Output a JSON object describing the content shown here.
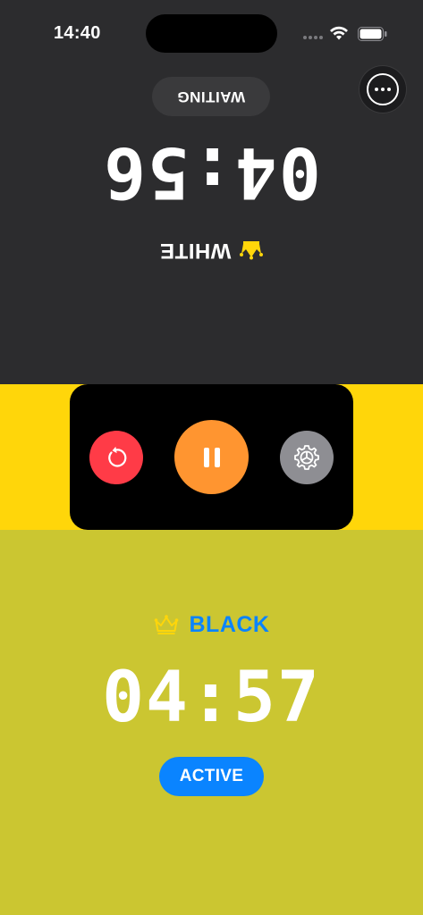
{
  "status_bar": {
    "time": "14:40",
    "icons": [
      "cellular-signal-icon",
      "wifi-icon",
      "battery-icon"
    ]
  },
  "top_player": {
    "name": "WHITE",
    "time": "04:56",
    "state": "WAITING",
    "crown_color": "#ffd60a",
    "orientation": "rotated-180"
  },
  "bottom_player": {
    "name": "BLACK",
    "time": "04:57",
    "state": "ACTIVE",
    "crown_color": "#ffd60a",
    "name_color": "#0a84ff"
  },
  "controls": {
    "reset_icon": "restart-arrow-icon",
    "pause_icon": "pause-icon",
    "settings_icon": "gear-icon",
    "menu_icon": "ellipsis-circle-icon"
  },
  "colors": {
    "top_background": "#2c2c2e",
    "middle_band": "#ffd60a",
    "bottom_background": "#cbc631",
    "reset": "#ff3b47",
    "pause": "#ff9530",
    "settings": "#8e8e93",
    "accent": "#0a84ff"
  }
}
